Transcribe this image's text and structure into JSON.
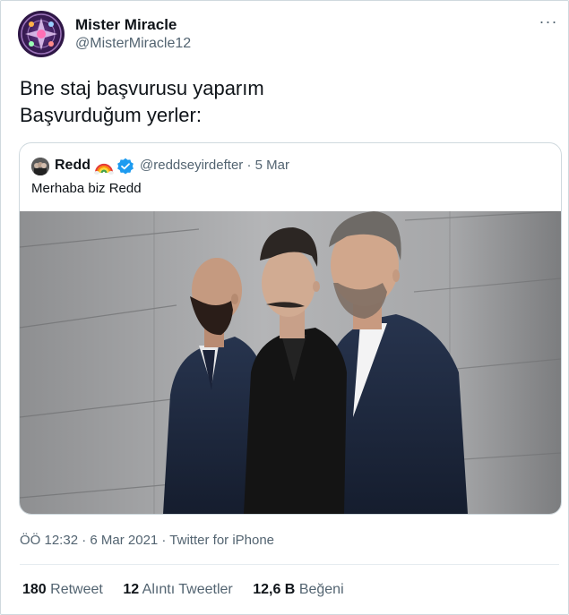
{
  "author": {
    "name": "Mister Miracle",
    "handle": "@MisterMiracle12"
  },
  "more_label": "···",
  "tweet": {
    "lines": [
      "Bne staj başvurusu yaparım",
      "Başvurduğum yerler:"
    ]
  },
  "quoted": {
    "name": "Redd",
    "handle": "@reddseyirdefter",
    "separator": " · ",
    "date": "5 Mar",
    "text": "Merhaba biz Redd"
  },
  "meta": {
    "timestamp": "ÖÖ 12:32 · 6 Mar 2021 · Twitter for iPhone"
  },
  "stats": [
    {
      "count": "180",
      "label": "Retweet"
    },
    {
      "count": "12",
      "label": "Alıntı Tweetler"
    },
    {
      "count": "12,6 B",
      "label": "Beğeni"
    }
  ],
  "colors": {
    "text": "#0f1419",
    "secondary": "#536471",
    "border": "#cfd9de",
    "verified": "#1d9bf0"
  },
  "icons": {
    "more": "more-horizontal-icon",
    "rainbow": "rainbow-icon",
    "verified": "verified-badge-icon"
  }
}
